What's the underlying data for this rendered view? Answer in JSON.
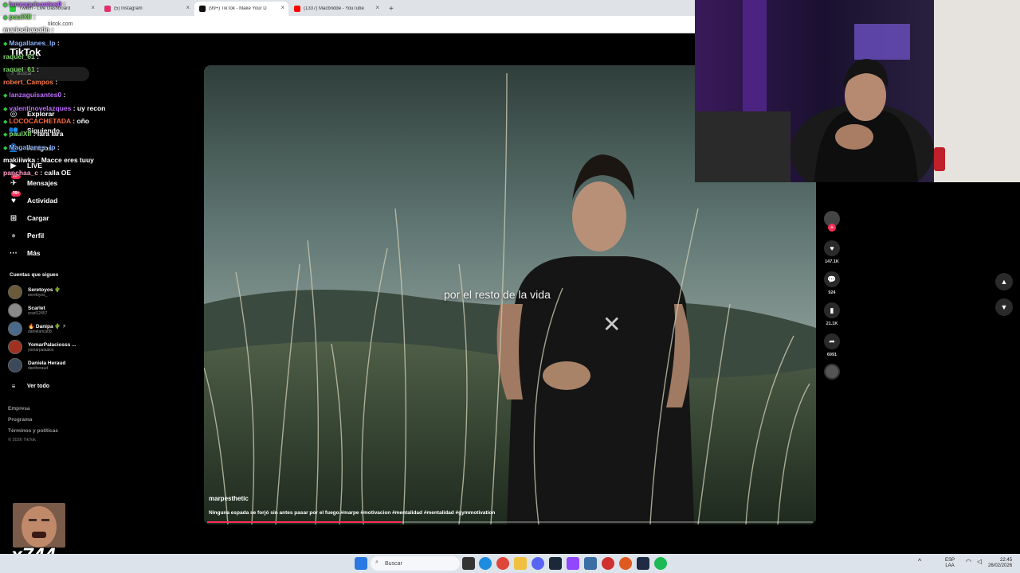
{
  "browser": {
    "tabs": [
      {
        "label": "Twitch - Live Dashboard",
        "color": "#2ecc40"
      },
      {
        "label": "(5) Instagram",
        "color": "#e1306c"
      },
      {
        "label": "(99+) TikTok - Make Your D",
        "color": "#111111"
      },
      {
        "label": "(1337) Macbridde - YouTube",
        "color": "#ff0000"
      }
    ],
    "new_tab": "+",
    "url": "tiktok.com"
  },
  "tiktok": {
    "logo": "TikTok",
    "search_placeholder": "Buscar",
    "nav": [
      {
        "label": "Explorar",
        "icon": "compass-icon",
        "glyph": "◎"
      },
      {
        "label": "Siguiendo",
        "icon": "following-icon",
        "glyph": "👥"
      },
      {
        "label": "Amigos",
        "icon": "friends-icon",
        "glyph": "👤"
      },
      {
        "label": "LIVE",
        "icon": "live-icon",
        "glyph": "▶"
      },
      {
        "label": "Mensajes",
        "icon": "messages-icon",
        "glyph": "✈",
        "badge": "99+"
      },
      {
        "label": "Actividad",
        "icon": "activity-icon",
        "glyph": "♥",
        "badge": "99+"
      },
      {
        "label": "Cargar",
        "icon": "upload-icon",
        "glyph": "⊞"
      },
      {
        "label": "Perfil",
        "icon": "profile-icon",
        "glyph": "●"
      },
      {
        "label": "Más",
        "icon": "more-icon",
        "glyph": "···"
      }
    ],
    "following_title": "Cuentas que sigues",
    "accounts": [
      {
        "name": "Seretoyos 🌵",
        "handle": "seretoyos_",
        "color": "#6a5a3a"
      },
      {
        "name": "Scarlet",
        "handle": "scarl12457",
        "color": "#8a8a8a"
      },
      {
        "name": "🔥 Danipa 🌵 ⚡",
        "handle": "danielarica08",
        "color": "#4a6a8a"
      },
      {
        "name": "YomarPalaciosss ...",
        "handle": "yomarpalaaios",
        "color": "#a03020"
      },
      {
        "name": "Daniela Heraud",
        "handle": "daniheraud",
        "color": "#3a4a5a"
      }
    ],
    "see_all": "Ver todo",
    "footer": [
      "Empresa",
      "Programa",
      "Términos y políticas"
    ],
    "copyright": "© 2026 TikTok"
  },
  "chat": [
    {
      "user": "lanzaguisantes0",
      "color": "#c06cff",
      "msg": ""
    },
    {
      "user": "paulXII",
      "color": "#7fd36b",
      "msg": ""
    },
    {
      "user": "mariochapatin",
      "color": "#ffffff",
      "msg": ""
    },
    {
      "user": "Magallanes_lp",
      "color": "#8ab4ff",
      "msg": ""
    },
    {
      "user": "raquel_61",
      "color": "#7fd36b",
      "msg": ""
    },
    {
      "user": "raquel_61",
      "color": "#7fd36b",
      "msg": ""
    },
    {
      "user": "robert_Campos",
      "color": "#ff7a4d",
      "msg": ""
    },
    {
      "user": "lanzaguisantes0",
      "color": "#c06cff",
      "msg": ""
    },
    {
      "user": "valentinovelazques",
      "color": "#c06cff",
      "msg": "uy recon"
    },
    {
      "user": "LOCOCACHETADA",
      "color": "#ff6a3d",
      "msg": "oño"
    },
    {
      "user": "paulXII",
      "color": "#7fd36b",
      "msg": "lara lara"
    },
    {
      "user": "Magallanes_lp",
      "color": "#8ab4ff",
      "msg": ""
    },
    {
      "user": "makiiiwka",
      "color": "#ffffff",
      "msg": "Macce eres tuuy"
    },
    {
      "user": "panchaa_c",
      "color": "#ff9ec7",
      "msg": "calla OE"
    }
  ],
  "video": {
    "caption": "por el resto de la vida",
    "author": "marpesthetic",
    "description": "Ninguna espada se forjó sin antes pasar por el fuego.#marpe #motivacion #mentalidad #mentalidad #gymmotivation",
    "progress": 0.32
  },
  "actions": [
    {
      "icon": "heart-icon",
      "glyph": "♥",
      "count": "147.1K"
    },
    {
      "icon": "comment-icon",
      "glyph": "💬",
      "count": "924"
    },
    {
      "icon": "bookmark-icon",
      "glyph": "▮",
      "count": "21.1K"
    },
    {
      "icon": "share-icon",
      "glyph": "➦",
      "count": "6991"
    }
  ],
  "sticker": {
    "count": "x744"
  },
  "taskbar": {
    "search": "Buscar",
    "lang": "ESP",
    "lang2": "LAA",
    "time": "22:45",
    "date": "26/02/2026"
  }
}
